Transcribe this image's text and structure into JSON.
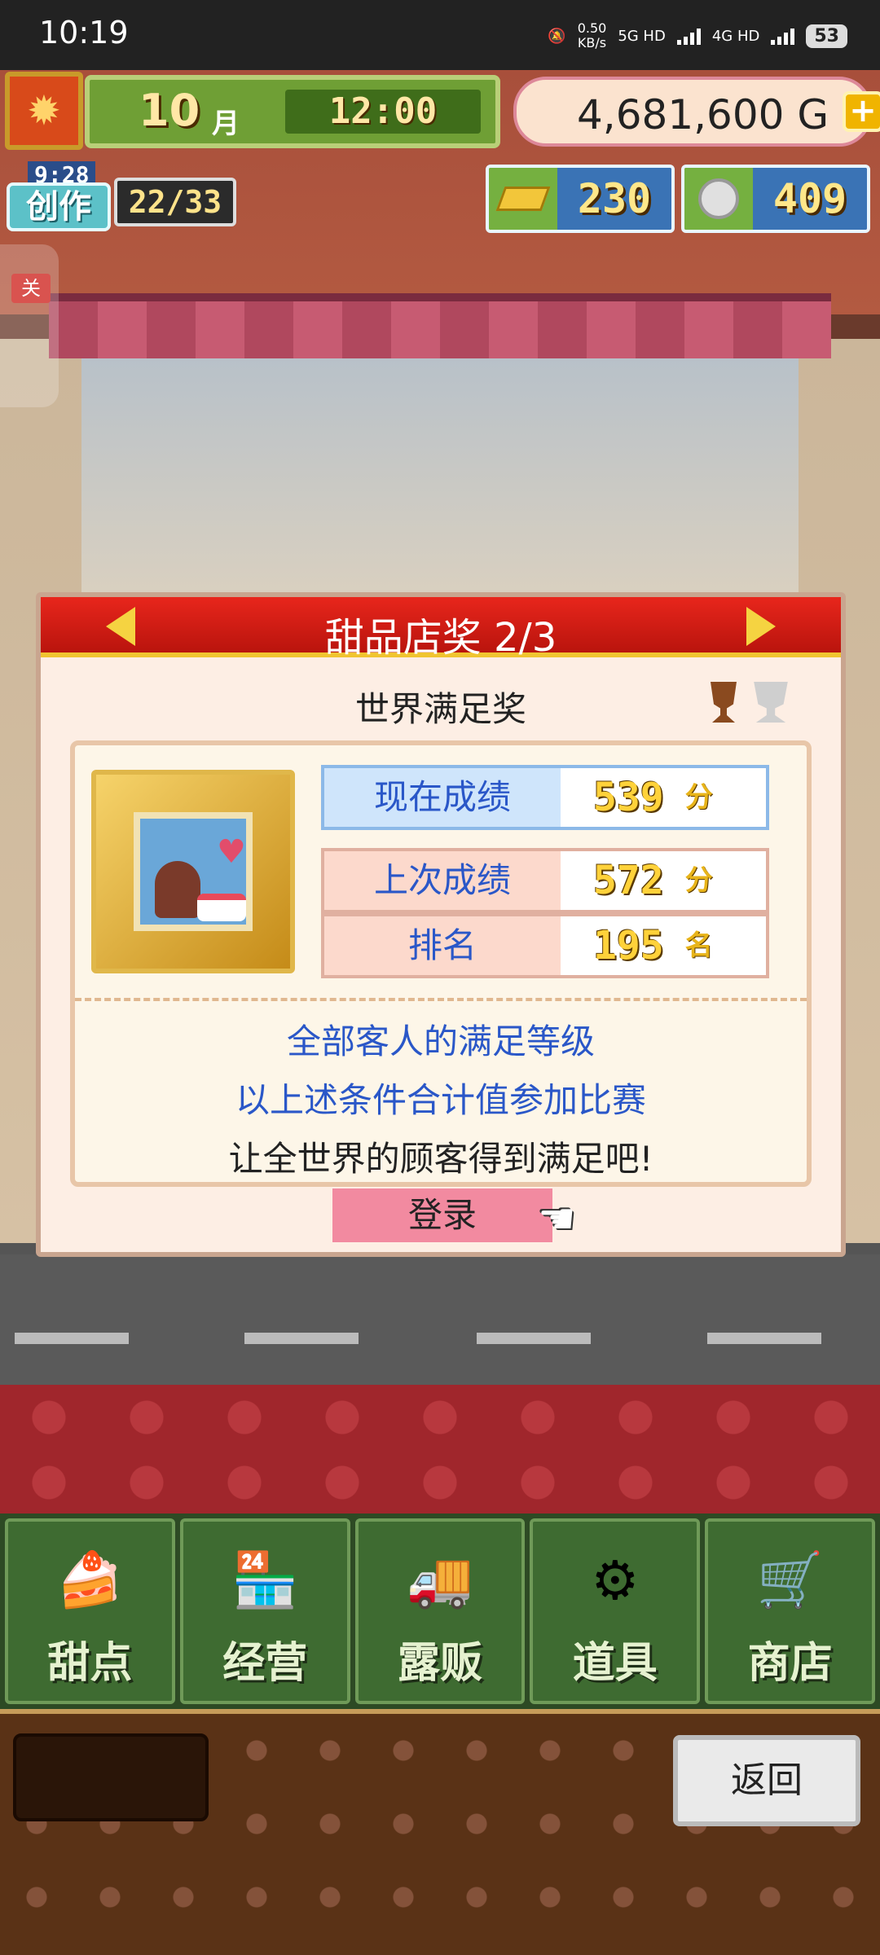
{
  "status_bar": {
    "time": "10:19",
    "net_speed": "0.50",
    "net_speed_unit": "KB/s",
    "network1": "5G HD",
    "network2": "4G HD",
    "battery": "53"
  },
  "hud": {
    "month_value": "10",
    "month_unit": "月",
    "clock": "12:00",
    "money": "4,681,600 G",
    "plus_label": "+",
    "create_timer": "9:28",
    "create_label": "创作",
    "create_count": "22/33",
    "close_label": "关",
    "gold_value": "230",
    "medal_value": "409"
  },
  "panel": {
    "title": "甜品店奖 2/3",
    "subtitle": "世界满足奖",
    "rows": [
      {
        "label": "现在成绩",
        "value": "539",
        "unit": "分"
      },
      {
        "label": "上次成绩",
        "value": "572",
        "unit": "分"
      },
      {
        "label": "排名",
        "value": "195",
        "unit": "名"
      }
    ],
    "desc1": "全部客人的满足等级",
    "desc2": "以上述条件合计值参加比赛",
    "desc3": "让全世界的顾客得到满足吧!",
    "login_label": "登录"
  },
  "menu": {
    "items": [
      {
        "label": "甜点",
        "icon": "cake-icon"
      },
      {
        "label": "经营",
        "icon": "shop-icon"
      },
      {
        "label": "露贩",
        "icon": "food-truck-icon"
      },
      {
        "label": "道具",
        "icon": "gear-bag-icon"
      },
      {
        "label": "商店",
        "icon": "cart-icon"
      }
    ]
  },
  "footer": {
    "back_label": "返回"
  }
}
